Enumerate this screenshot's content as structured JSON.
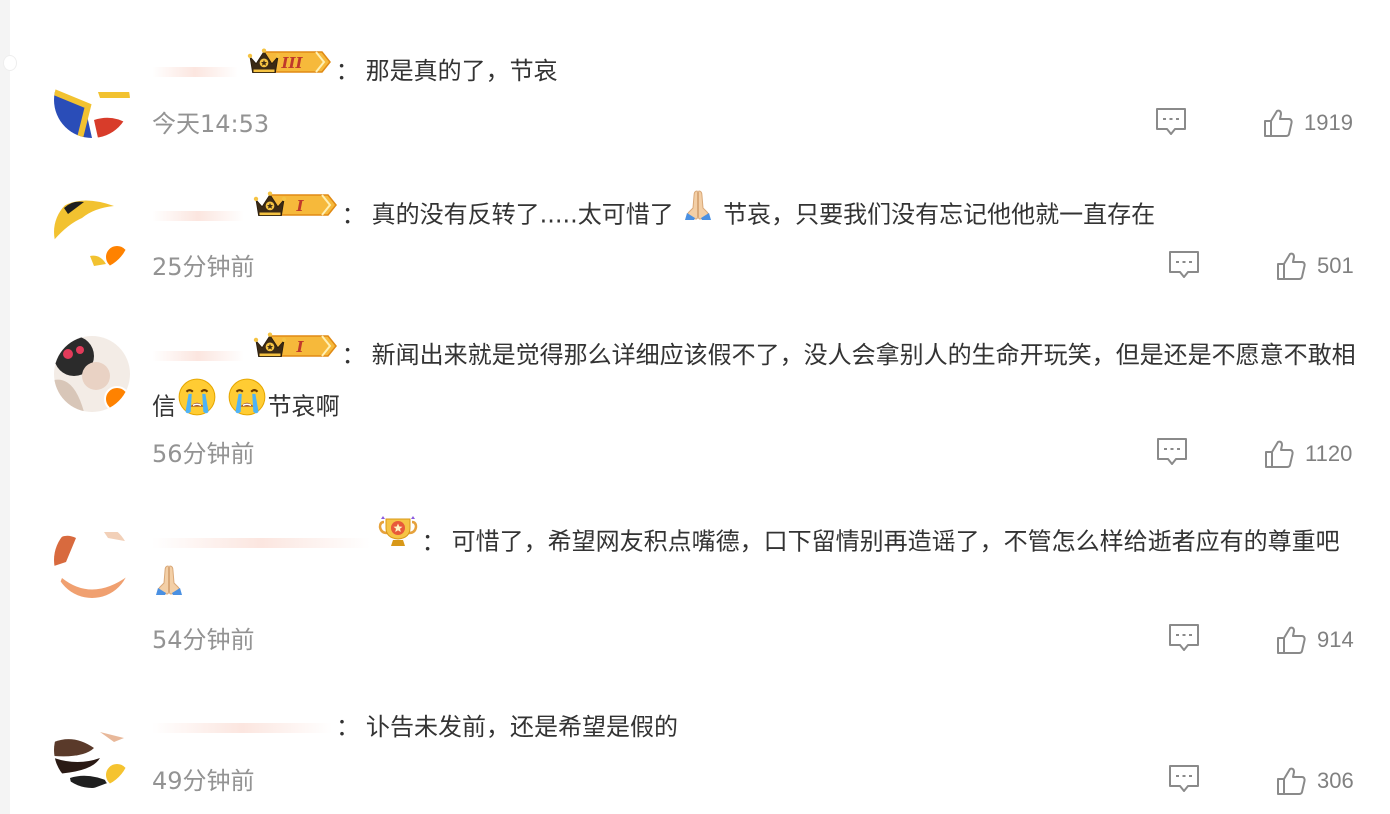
{
  "comments": [
    {
      "text": "那是真的了，节哀",
      "time": "今天14:53",
      "likes": "1919",
      "badge": "crown-III"
    },
    {
      "text": "真的没有反转了.....太可惜了",
      "text2": "节哀，只要我们没有忘记他他就一直存在",
      "time": "25分钟前",
      "likes": "501",
      "badge": "crown-I"
    },
    {
      "text": "新闻出来就是觉得那么详细应该假不了，没人会拿别人的生命开玩笑，但是还是不愿意不敢相信",
      "text2": "节哀啊",
      "time": "56分钟前",
      "likes": "1120",
      "badge": "crown-I"
    },
    {
      "text": "可惜了，希望网友积点嘴德，口下留情别再造谣了，不管怎么样给逝者应有的尊重吧",
      "time": "54分钟前",
      "likes": "914",
      "badge": "trophy"
    },
    {
      "text": "讣告未发前，还是希望是假的",
      "time": "49分钟前",
      "likes": "306",
      "badge": ""
    }
  ],
  "separator": "：",
  "badge_labels": {
    "crown3": "III",
    "crown1": "I"
  },
  "icons": {
    "reply": "comment-icon",
    "like": "thumbs-up-icon",
    "pray": "praying-hands-emoji",
    "cry": "crying-face-emoji"
  },
  "colors": {
    "username": "#eb7350",
    "time": "#939393",
    "text": "#333333",
    "like_count": "#808080"
  }
}
